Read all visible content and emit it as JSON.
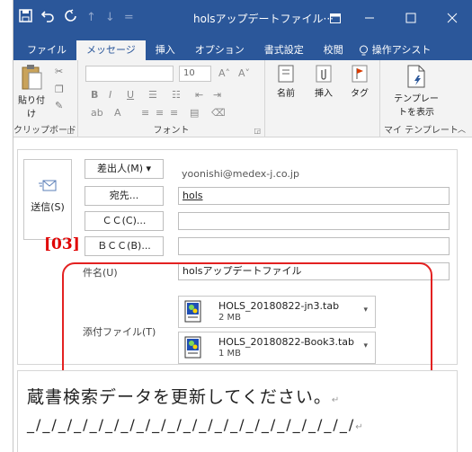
{
  "window": {
    "title": "holsアップデートファイル···"
  },
  "qat": {
    "save_icon": "save-icon",
    "undo_icon": "undo-icon",
    "redo_icon": "redo-icon",
    "up_glyph": "↑",
    "down_glyph": "↓",
    "customize_glyph": "="
  },
  "tabs": [
    {
      "label": "ファイル"
    },
    {
      "label": "メッセージ"
    },
    {
      "label": "挿入"
    },
    {
      "label": "オプション"
    },
    {
      "label": "書式設定"
    },
    {
      "label": "校閲"
    }
  ],
  "tell_me": "操作アシスト",
  "ribbon": {
    "paste_label": "貼り付け",
    "clipboard_group": "クリップボード",
    "font_size": "10",
    "font_group": "フォント",
    "names_label": "名前",
    "insert_label": "挿入",
    "tags_label": "タグ",
    "template_label_1": "テンプレー",
    "template_label_2": "トを表示",
    "my_templates_group": "マイ テンプレート",
    "bold": "B",
    "italic": "I",
    "underline": "U"
  },
  "compose": {
    "send_label": "送信(S)",
    "from_button": "差出人(M) ▾",
    "from_value": "yoonishi@medex-j.co.jp",
    "to_button": "宛先...",
    "to_value": "hols",
    "cc_button": "ＣＣ(C)...",
    "cc_value": "",
    "bcc_button": "ＢＣＣ(B)...",
    "bcc_value": "",
    "subject_label": "件名(U)",
    "subject_value": "holsアップデートファイル",
    "attachments_label": "添付ファイル(T)",
    "attachments": [
      {
        "name": "HOLS_20180822-jn3.tab",
        "size": "2 MB"
      },
      {
        "name": "HOLS_20180822-Book3.tab",
        "size": "1 MB"
      }
    ],
    "annotation": "[03]"
  },
  "body": {
    "line1": "蔵書検索データを更新してください。",
    "line2": "_/_/_/_/_/_/_/_/_/_/_/_/_/_/_/_/_/_/_/_/_/"
  },
  "colors": {
    "title_bar": "#2b579a",
    "highlight_frame": "#e32121",
    "annotation": "#e00000"
  }
}
